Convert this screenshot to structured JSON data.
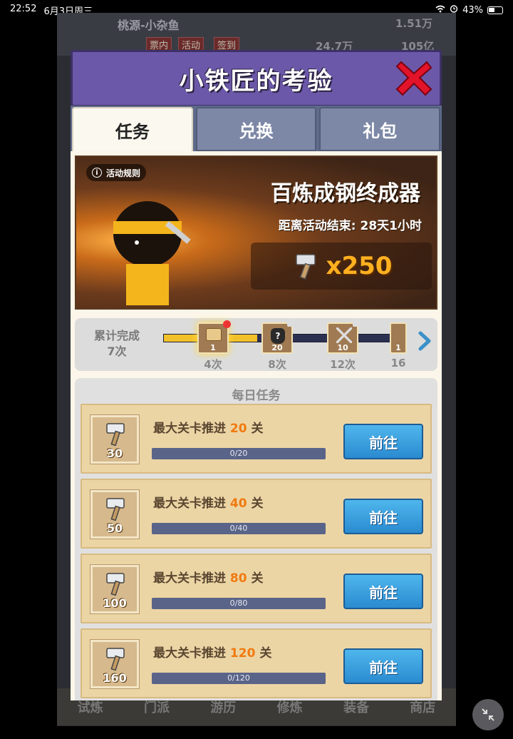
{
  "status_bar": {
    "time": "22:52",
    "date": "6月3日周三",
    "battery": "43%"
  },
  "background": {
    "player_name": "桃源-小杂鱼",
    "tags": [
      "票内",
      "活动",
      "签到"
    ],
    "resources": [
      "1.51万",
      "24.7万",
      "105亿"
    ],
    "bottom_nav": [
      "试炼",
      "门派",
      "游历",
      "修炼",
      "装备",
      "商店"
    ]
  },
  "modal": {
    "title": "小铁匠的考验",
    "tabs": [
      {
        "label": "任务",
        "active": true
      },
      {
        "label": "兑换",
        "active": false
      },
      {
        "label": "礼包",
        "active": false
      }
    ]
  },
  "banner": {
    "rules_label": "活动规则",
    "title": "百炼成钢终成器",
    "countdown": "距离活动结束: 28天1小时",
    "reward": "x250"
  },
  "progress": {
    "accumulated_label": "累计完成",
    "accumulated_count": "7次",
    "fill_fraction": 0.4,
    "milestones": [
      {
        "count": "1",
        "label": "4次",
        "active": true
      },
      {
        "count": "20",
        "label": "8次",
        "active": false
      },
      {
        "count": "10",
        "label": "12次",
        "active": false
      },
      {
        "count": "1",
        "label": "16",
        "active": false
      }
    ]
  },
  "daily": {
    "title": "每日任务",
    "tasks": [
      {
        "reward": "30",
        "prefix": "最大关卡推进",
        "value": "20",
        "suffix": "关",
        "progress": "0/20",
        "button": "前往"
      },
      {
        "reward": "50",
        "prefix": "最大关卡推进",
        "value": "40",
        "suffix": "关",
        "progress": "0/40",
        "button": "前往"
      },
      {
        "reward": "100",
        "prefix": "最大关卡推进",
        "value": "80",
        "suffix": "关",
        "progress": "0/80",
        "button": "前往"
      },
      {
        "reward": "160",
        "prefix": "最大关卡推进",
        "value": "120",
        "suffix": "关",
        "progress": "0/120",
        "button": "前往"
      }
    ]
  },
  "colors": {
    "header": "#6b58a8",
    "go_button": "#2a8bd0",
    "highlight": "#f07a10"
  }
}
